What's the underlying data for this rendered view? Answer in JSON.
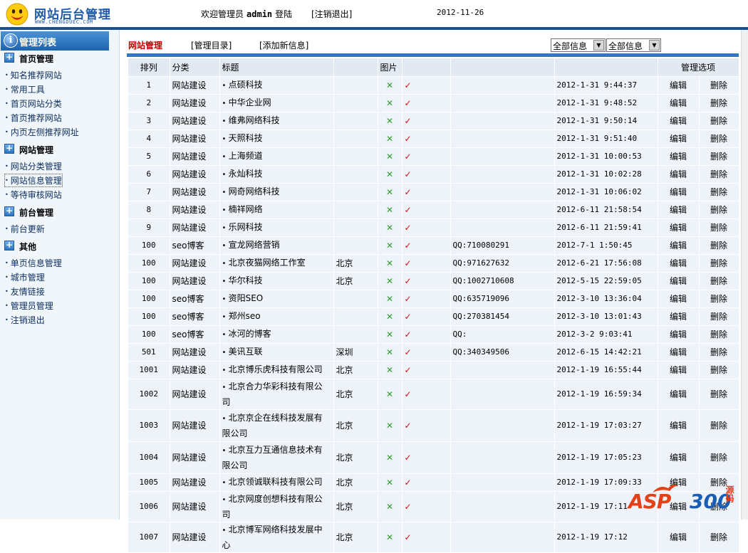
{
  "header": {
    "site_title": "网站后台管理",
    "site_url": "WWW.CHENGDUEC.COM",
    "welcome_prefix": "欢迎管理员",
    "username": "admin",
    "welcome_suffix": "登陆",
    "logout": "[注销退出]",
    "date": "2012-11-26"
  },
  "sidebar": {
    "head": "管理列表",
    "groups": [
      {
        "label": "首页管理",
        "items": [
          "知名推荐网站",
          "常用工具",
          "首页网站分类",
          "首页推荐网站",
          "内页左侧推荐网址"
        ]
      },
      {
        "label": "网站管理",
        "items": [
          "网站分类管理",
          "网站信息管理",
          "等待审核网站"
        ]
      },
      {
        "label": "前台管理",
        "items": [
          "前台更新"
        ]
      },
      {
        "label": "其他",
        "items": [
          "单页信息管理",
          "城市管理",
          "友情链接",
          "管理员管理",
          "注销退出"
        ]
      }
    ]
  },
  "main": {
    "title": "网站管理",
    "link_dir": "[管理目录]",
    "link_add": "[添加新信息]",
    "filter1": "全部信息",
    "filter2": "全部信息"
  },
  "table": {
    "headers": {
      "rank": "排列",
      "category": "分类",
      "title": "标题",
      "image": "图片",
      "options": "管理选项"
    },
    "x_mark": "✕",
    "check_mark": "✓",
    "edit": "编辑",
    "delete": "删除",
    "rows": [
      {
        "rank": "1",
        "category": "网站建设",
        "title": "点硕科技",
        "city": "",
        "qq": "",
        "date": "2012-1-31 9:44:37"
      },
      {
        "rank": "2",
        "category": "网站建设",
        "title": "中华企业网",
        "city": "",
        "qq": "",
        "date": "2012-1-31 9:48:52"
      },
      {
        "rank": "3",
        "category": "网站建设",
        "title": "维弗网络科技",
        "city": "",
        "qq": "",
        "date": "2012-1-31 9:50:14"
      },
      {
        "rank": "4",
        "category": "网站建设",
        "title": "天照科技",
        "city": "",
        "qq": "",
        "date": "2012-1-31 9:51:40"
      },
      {
        "rank": "5",
        "category": "网站建设",
        "title": "上海频道",
        "city": "",
        "qq": "",
        "date": "2012-1-31 10:00:53"
      },
      {
        "rank": "6",
        "category": "网站建设",
        "title": "永灿科技",
        "city": "",
        "qq": "",
        "date": "2012-1-31 10:02:28"
      },
      {
        "rank": "7",
        "category": "网站建设",
        "title": "网奇网络科技",
        "city": "",
        "qq": "",
        "date": "2012-1-31 10:06:02"
      },
      {
        "rank": "8",
        "category": "网站建设",
        "title": "楠祥网络",
        "city": "",
        "qq": "",
        "date": "2012-6-11 21:58:54"
      },
      {
        "rank": "9",
        "category": "网站建设",
        "title": "乐网科技",
        "city": "",
        "qq": "",
        "date": "2012-6-11 21:59:41"
      },
      {
        "rank": "100",
        "category": "seo博客",
        "title": "宣龙网络营销",
        "city": "",
        "qq": "QQ:710080291",
        "date": "2012-7-1 1:50:45"
      },
      {
        "rank": "100",
        "category": "网站建设",
        "title": "北京夜猫网络工作室",
        "city": "北京",
        "qq": "QQ:971627632",
        "date": "2012-6-21 17:56:08"
      },
      {
        "rank": "100",
        "category": "网站建设",
        "title": "华尔科技",
        "city": "北京",
        "qq": "QQ:1002710608",
        "date": "2012-5-15 22:59:05"
      },
      {
        "rank": "100",
        "category": "seo博客",
        "title": "资阳SEO",
        "city": "",
        "qq": "QQ:635719096",
        "date": "2012-3-10 13:36:04"
      },
      {
        "rank": "100",
        "category": "seo博客",
        "title": "郑州seo",
        "city": "",
        "qq": "QQ:270381454",
        "date": "2012-3-10 13:01:43"
      },
      {
        "rank": "100",
        "category": "seo博客",
        "title": "冰河的博客",
        "city": "",
        "qq": "QQ:",
        "date": "2012-3-2 9:03:41"
      },
      {
        "rank": "501",
        "category": "网站建设",
        "title": "美讯互联",
        "city": "深圳",
        "qq": "QQ:340349506",
        "date": "2012-6-15 14:42:21"
      },
      {
        "rank": "1001",
        "category": "网站建设",
        "title": "北京博乐虎科技有限公司",
        "city": "北京",
        "qq": "",
        "date": "2012-1-19 16:55:44"
      },
      {
        "rank": "1002",
        "category": "网站建设",
        "title": "北京合力华彩科技有限公司",
        "city": "北京",
        "qq": "",
        "date": "2012-1-19 16:59:34"
      },
      {
        "rank": "1003",
        "category": "网站建设",
        "title": "北京京企在线科技发展有限公司",
        "city": "北京",
        "qq": "",
        "date": "2012-1-19 17:03:27"
      },
      {
        "rank": "1004",
        "category": "网站建设",
        "title": "北京互力互通信息技术有限公司",
        "city": "北京",
        "qq": "",
        "date": "2012-1-19 17:05:23"
      },
      {
        "rank": "1005",
        "category": "网站建设",
        "title": "北京领诚联科技有限公司",
        "city": "北京",
        "qq": "",
        "date": "2012-1-19 17:09:33"
      },
      {
        "rank": "1006",
        "category": "网站建设",
        "title": "北京网度创想科技有限公司",
        "city": "北京",
        "qq": "",
        "date": "2012-1-19 17:11"
      },
      {
        "rank": "1007",
        "category": "网站建设",
        "title": "北京博军网络科技发展中心",
        "city": "北京",
        "qq": "",
        "date": "2012-1-19 17:12"
      }
    ]
  },
  "watermark": {
    "brand": "ASP",
    "num": "300",
    "tail": "源码"
  },
  "colors": {
    "accent": "#1c4f8c",
    "bar": "#2f78c3",
    "title_red": "#c00000",
    "x_green": "#2e9a2e",
    "check_red": "#d01010"
  }
}
